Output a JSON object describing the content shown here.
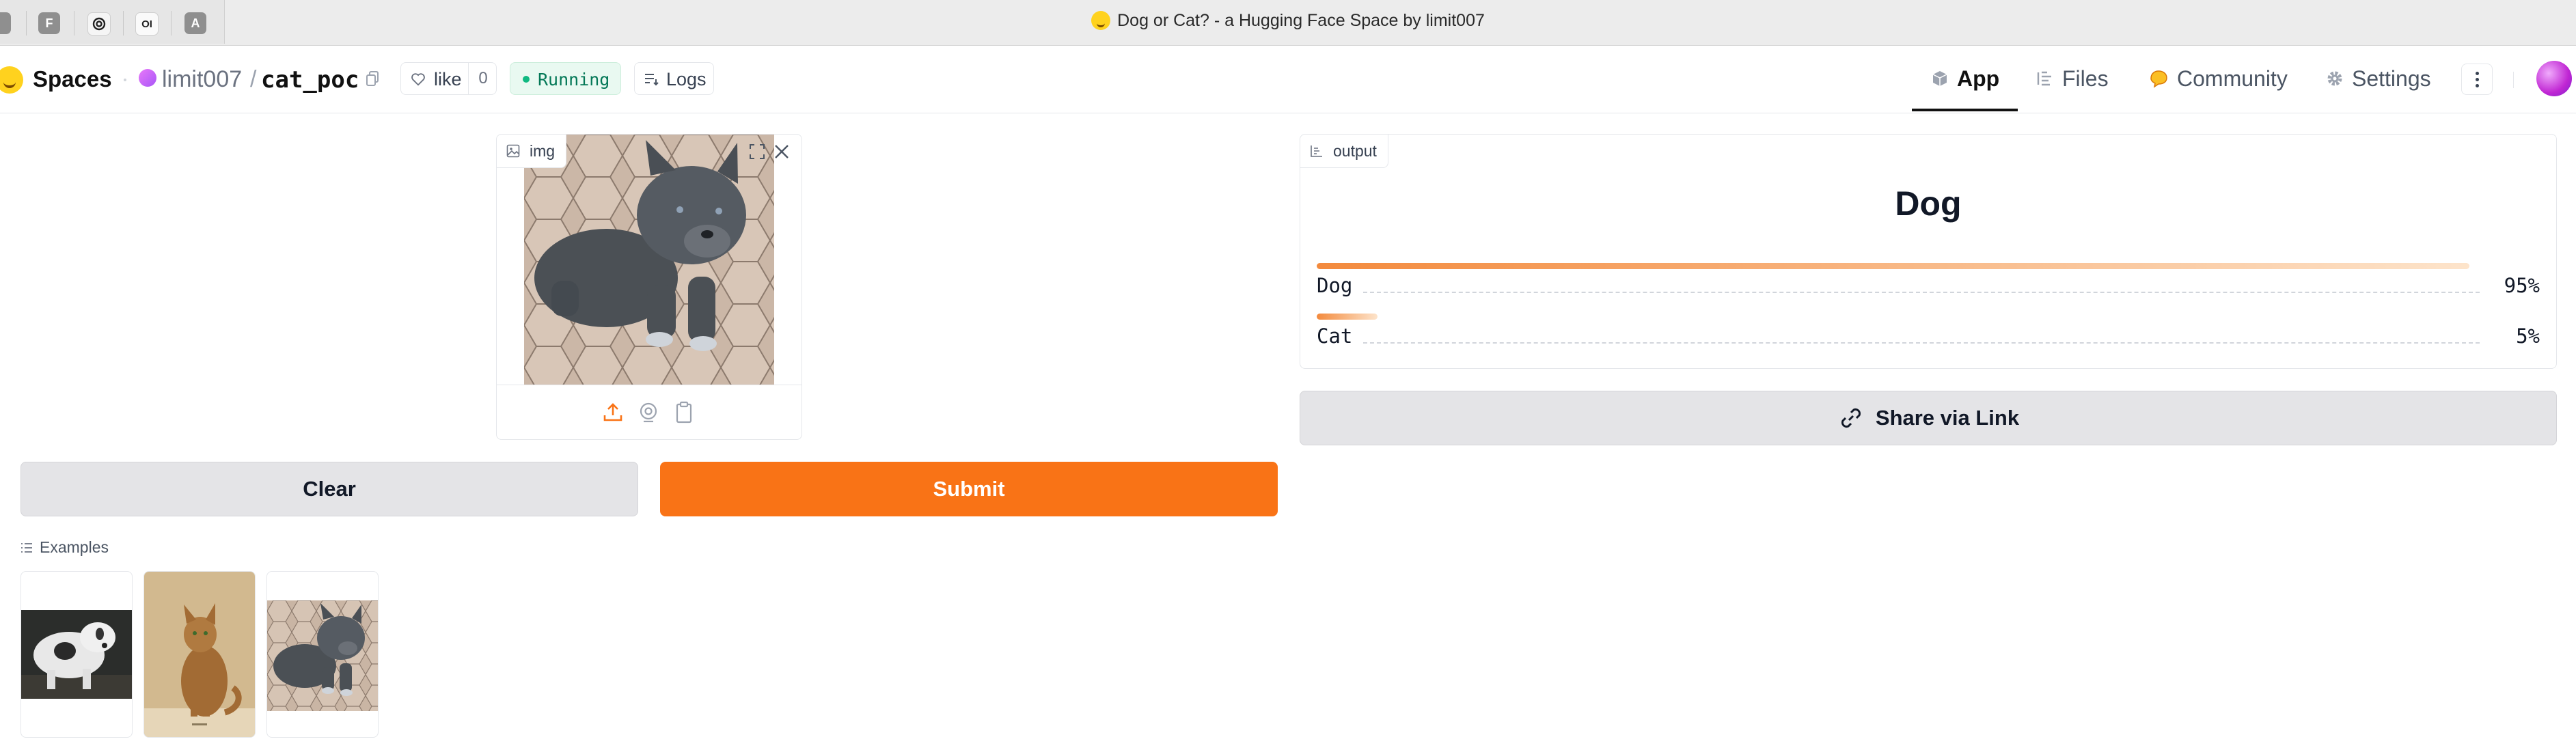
{
  "browser": {
    "window_title": "Dog or Cat? - a Hugging Face Space by limit007",
    "pinned_tabs": [
      "F",
      "OI",
      "A"
    ]
  },
  "header": {
    "brand": "Spaces",
    "owner": "limit007",
    "separator": "/",
    "repo": "cat_poc",
    "like_label": "like",
    "like_count": "0",
    "status": "Running",
    "logs_label": "Logs",
    "nav_tabs": [
      {
        "label": "App",
        "icon": "cube-icon",
        "active": true
      },
      {
        "label": "Files",
        "icon": "files-icon",
        "active": false
      },
      {
        "label": "Community",
        "icon": "community-icon",
        "active": false
      },
      {
        "label": "Settings",
        "icon": "gear-icon",
        "active": false
      }
    ]
  },
  "input": {
    "label": "img",
    "image": "gray puppy on hexagonal paving tiles"
  },
  "output": {
    "label": "output",
    "prediction": "Dog",
    "confidences": [
      {
        "label": "Dog",
        "percent": "95%",
        "value": 0.95
      },
      {
        "label": "Cat",
        "percent": "5%",
        "value": 0.05
      }
    ]
  },
  "buttons": {
    "share": "Share via Link",
    "clear": "Clear",
    "submit": "Submit"
  },
  "examples": {
    "label": "Examples",
    "items": [
      "black and white dog",
      "abyssinian cat",
      "gray puppy on tiles"
    ]
  },
  "colors": {
    "accent": "#f97316",
    "running": "#10b981",
    "button_secondary": "#e4e4e7"
  }
}
